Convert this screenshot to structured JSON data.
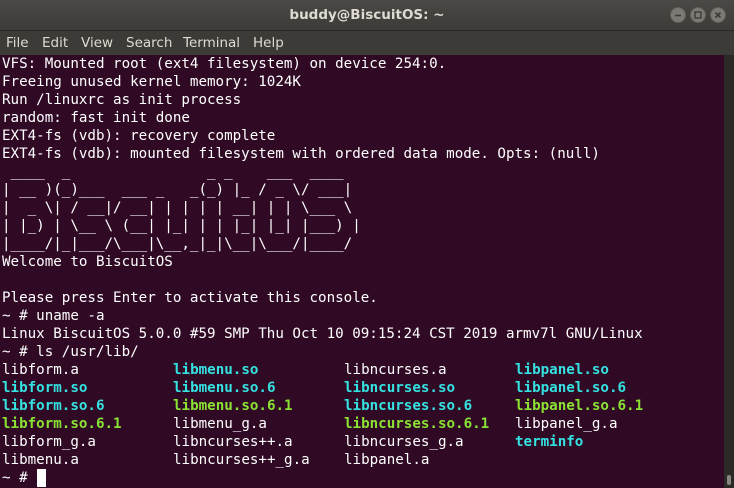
{
  "window": {
    "title": "buddy@BiscuitOS: ~",
    "accent_color": "#300a24"
  },
  "controls": {
    "minimize_icon": "minimize-icon",
    "maximize_icon": "maximize-icon",
    "close_icon": "close-icon"
  },
  "menubar": {
    "items": [
      "File",
      "Edit",
      "View",
      "Search",
      "Terminal",
      "Help"
    ]
  },
  "terminal": {
    "lines": [
      "VFS: Mounted root (ext4 filesystem) on device 254:0.",
      "Freeing unused kernel memory: 1024K",
      "Run /linuxrc as init process",
      "random: fast init done",
      "EXT4-fs (vdb): recovery complete",
      "EXT4-fs (vdb): mounted filesystem with ordered data mode. Opts: (null)",
      " ____  _                _ _    ___  ____  ",
      "| __ )(_)___  ___ _   _(_) |_ / _ \\/ ___| ",
      "|  _ \\| / __|/ __| | | | | __| | | \\___ \\ ",
      "| |_) | \\__ \\ (__| |_| | | |_| |_| |___) |",
      "|____/|_|___/\\___|\\__,_|_|\\__|\\___/|____/ ",
      "Welcome to BiscuitOS",
      "",
      "Please press Enter to activate this console.",
      "~ # uname -a",
      "Linux BiscuitOS 5.0.0 #59 SMP Thu Oct 10 09:15:24 CST 2019 armv7l GNU/Linux",
      "~ # ls /usr/lib/"
    ],
    "ls_output": [
      [
        {
          "name": "libform.a",
          "kind": "file"
        },
        {
          "name": "libmenu.so",
          "kind": "link"
        },
        {
          "name": "libncurses.a",
          "kind": "file"
        },
        {
          "name": "libpanel.so",
          "kind": "link"
        }
      ],
      [
        {
          "name": "libform.so",
          "kind": "link"
        },
        {
          "name": "libmenu.so.6",
          "kind": "link"
        },
        {
          "name": "libncurses.so",
          "kind": "link"
        },
        {
          "name": "libpanel.so.6",
          "kind": "link"
        }
      ],
      [
        {
          "name": "libform.so.6",
          "kind": "link"
        },
        {
          "name": "libmenu.so.6.1",
          "kind": "exec"
        },
        {
          "name": "libncurses.so.6",
          "kind": "link"
        },
        {
          "name": "libpanel.so.6.1",
          "kind": "exec"
        }
      ],
      [
        {
          "name": "libform.so.6.1",
          "kind": "exec"
        },
        {
          "name": "libmenu_g.a",
          "kind": "file"
        },
        {
          "name": "libncurses.so.6.1",
          "kind": "exec"
        },
        {
          "name": "libpanel_g.a",
          "kind": "file"
        }
      ],
      [
        {
          "name": "libform_g.a",
          "kind": "file"
        },
        {
          "name": "libncurses++.a",
          "kind": "file"
        },
        {
          "name": "libncurses_g.a",
          "kind": "file"
        },
        {
          "name": "terminfo",
          "kind": "link"
        }
      ],
      [
        {
          "name": "libmenu.a",
          "kind": "file"
        },
        {
          "name": "libncurses++_g.a",
          "kind": "file"
        },
        {
          "name": "libpanel.a",
          "kind": "file"
        }
      ]
    ],
    "prompt": "~ # "
  }
}
